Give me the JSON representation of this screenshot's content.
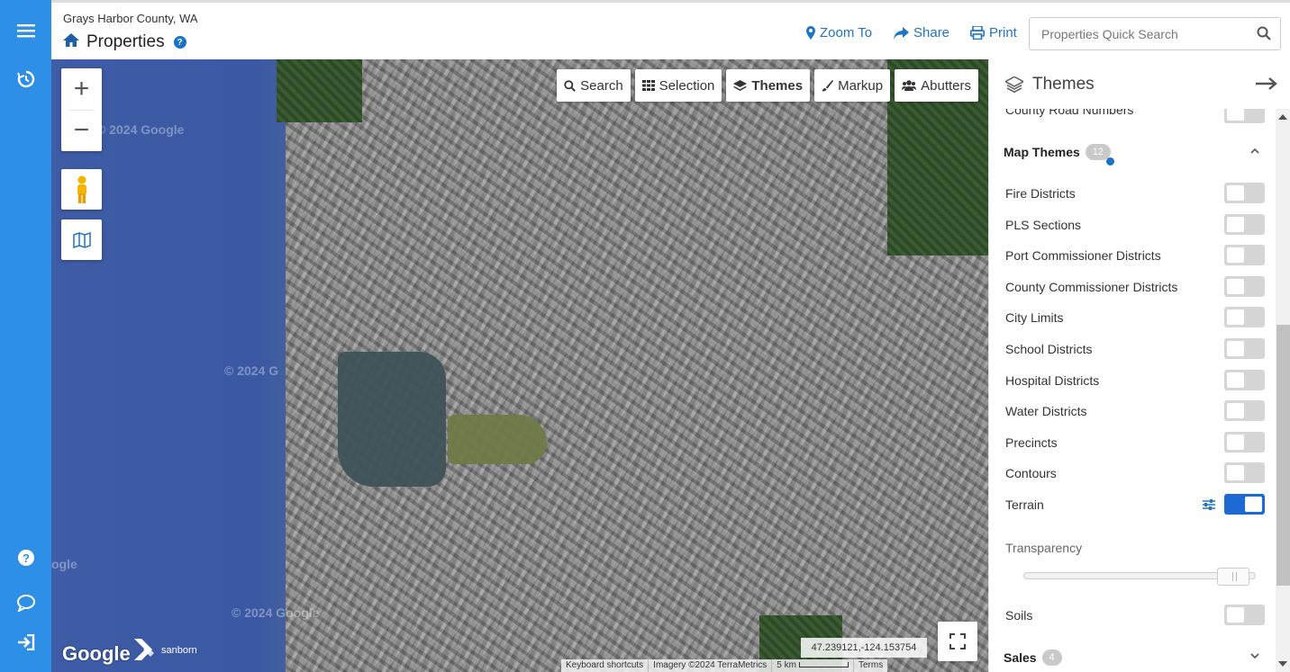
{
  "rail": {
    "menu_icon": "hamburger-menu-icon",
    "history_icon": "history-icon",
    "help_icon": "help-circle-icon",
    "chat_icon": "chat-bubble-icon",
    "login_icon": "sign-in-icon",
    "color": "#2e8fe6"
  },
  "header": {
    "county": "Grays Harbor County, WA",
    "title": "Properties",
    "help_badge": "?",
    "zoom_to": "Zoom To",
    "share": "Share",
    "print": "Print",
    "search_placeholder": "Properties Quick Search"
  },
  "map": {
    "toolbar": [
      {
        "label": "Search",
        "icon": "search-icon",
        "active": false
      },
      {
        "label": "Selection",
        "icon": "grid-icon",
        "active": false
      },
      {
        "label": "Themes",
        "icon": "layers-icon",
        "active": true
      },
      {
        "label": "Markup",
        "icon": "brush-icon",
        "active": false
      },
      {
        "label": "Abutters",
        "icon": "users-icon",
        "active": false
      }
    ],
    "zoom_in": "+",
    "zoom_out": "−",
    "watermark": "© 2024 Google",
    "watermark_partial": "© 2024 G",
    "watermark_partial2": "ogle",
    "google_logo": "Google",
    "sanborn": "sanborn",
    "coordinates": "47.239121,-124.153754",
    "attribution": {
      "shortcuts": "Keyboard shortcuts",
      "imagery": "Imagery ©2024 TerraMetrics",
      "scale": "5 km",
      "terms": "Terms"
    }
  },
  "panel": {
    "title": "Themes",
    "clipped_item": "County Road Numbers",
    "group_title": "Map Themes",
    "group_count": "12",
    "themes": [
      {
        "label": "Fire Districts",
        "on": false
      },
      {
        "label": "PLS Sections",
        "on": false
      },
      {
        "label": "Port Commissioner Districts",
        "on": false
      },
      {
        "label": "County Commissioner Districts",
        "on": false
      },
      {
        "label": "City Limits",
        "on": false
      },
      {
        "label": "School Districts",
        "on": false
      },
      {
        "label": "Hospital Districts",
        "on": false
      },
      {
        "label": "Water Districts",
        "on": false
      },
      {
        "label": "Precincts",
        "on": false
      },
      {
        "label": "Contours",
        "on": false
      },
      {
        "label": "Terrain",
        "on": true
      }
    ],
    "transparency_label": "Transparency",
    "transparency_value": 0.97,
    "soils": {
      "label": "Soils",
      "on": false
    },
    "sales_title": "Sales",
    "sales_count": "4",
    "accent": "#1e6ad4"
  }
}
